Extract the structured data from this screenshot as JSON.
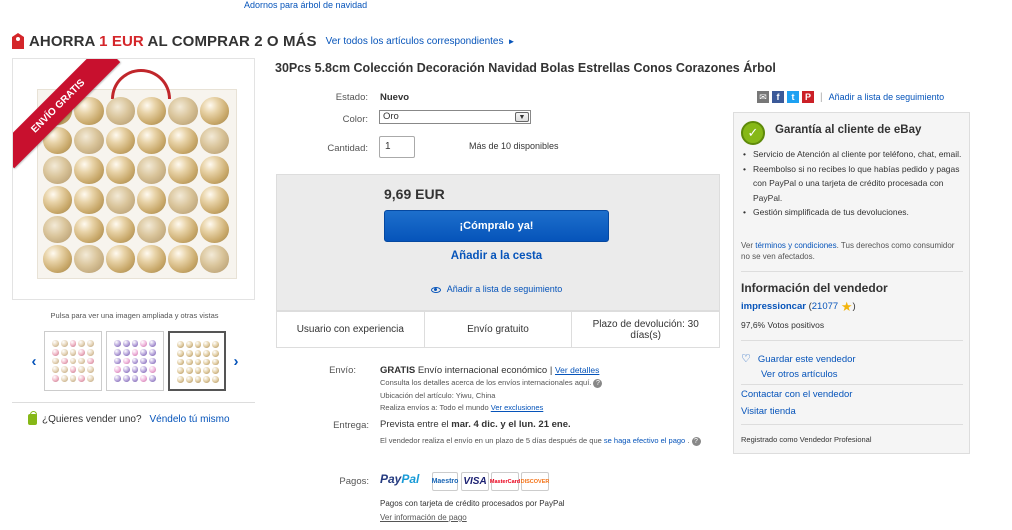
{
  "breadcrumb": "Adornos para árbol de navidad",
  "promo": {
    "prefix": "AHORRA ",
    "amount": "1 EUR",
    "suffix": " AL COMPRAR 2 O MÁS",
    "link": "Ver todos los artículos correspondientes",
    "link_arrow": "►"
  },
  "image": {
    "banner": "ENVÍO GRATIS",
    "hint": "Pulsa para ver una imagen ampliada y otras vistas",
    "prev_icon": "‹",
    "next_icon": "›"
  },
  "sell": {
    "question": "¿Quieres vender uno?",
    "link": "Véndelo tú mismo"
  },
  "title": "30Pcs 5.8cm Colección Decoración Navidad Bolas Estrellas Conos Corazones Árbol",
  "details": {
    "estado_label": "Estado:",
    "estado_value": "Nuevo",
    "color_label": "Color:",
    "color_value": "Oro",
    "cantidad_label": "Cantidad:",
    "cantidad_value": "1",
    "disponibles": "Más de 10 disponibles"
  },
  "buybox": {
    "price": "9,69 EUR",
    "buy_now": "¡Cómpralo ya!",
    "add_cart": "Añadir a la cesta",
    "watch": "Añadir a lista de seguimiento",
    "features": [
      "Usuario con experiencia",
      "Envío gratuito",
      "Plazo de devolución: 30 días(s)"
    ]
  },
  "shipping": {
    "envio_label": "Envío:",
    "gratis": "GRATIS",
    "method": " Envío internacional económico | ",
    "details_link": "Ver detalles",
    "consult": "Consulta los detalles acerca de los envíos internacionales aquí.",
    "location": "Ubicación del artículo: Yiwu, China",
    "realiza_prefix": "Realiza envíos a:  Todo el mundo  ",
    "exclusions_link": "Ver exclusiones",
    "entrega_label": "Entrega:",
    "entrega_prefix": "Prevista entre el ",
    "entrega_dates": "mar. 4 dic. y el lun. 21 ene.",
    "entrega_note": "El vendedor realiza el envío en un plazo de 5 días después de que ",
    "entrega_note_link": "se haga efectivo el pago",
    "entrega_note_end": " ."
  },
  "payment": {
    "label": "Pagos:",
    "paypal_a": "Pay",
    "paypal_b": "Pal",
    "cards": [
      "Maestro",
      "VISA",
      "MasterCard",
      "DISCOVER"
    ],
    "note": "Pagos con tarjeta de crédito procesados por PayPal",
    "info_link": "Ver información de pago"
  },
  "share": {
    "icons": [
      "mail-icon",
      "facebook-icon",
      "twitter-icon",
      "pinterest-icon"
    ],
    "separator": "|",
    "watchlist": "Añadir a lista de seguimiento"
  },
  "guarantee": {
    "title": "Garantía al cliente de eBay",
    "bullets": [
      "Servicio de Atención al cliente por teléfono, chat, email.",
      "Reembolso si no recibes lo que habías pedido y pagas con PayPal o una tarjeta de crédito procesada con PayPal.",
      "Gestión simplificada de tus devoluciones."
    ],
    "note_prefix": "Ver ",
    "note_link": "términos y condiciones",
    "note_suffix": ". Tus derechos como consumidor no se ven afectados."
  },
  "seller": {
    "title": "Información del vendedor",
    "name": "impressioncar",
    "score": "21077",
    "positive": "97,6% Votos positivos",
    "save": "Guardar este vendedor",
    "other": "Ver otros artículos",
    "contact": "Contactar con el vendedor",
    "store": "Visitar tienda",
    "registered": "Registrado como Vendedor Profesional"
  },
  "colors": {
    "link": "#0654ba",
    "promo_red": "#d4262a",
    "buy_button": "#0654ba",
    "guarantee_green": "#86b817"
  }
}
